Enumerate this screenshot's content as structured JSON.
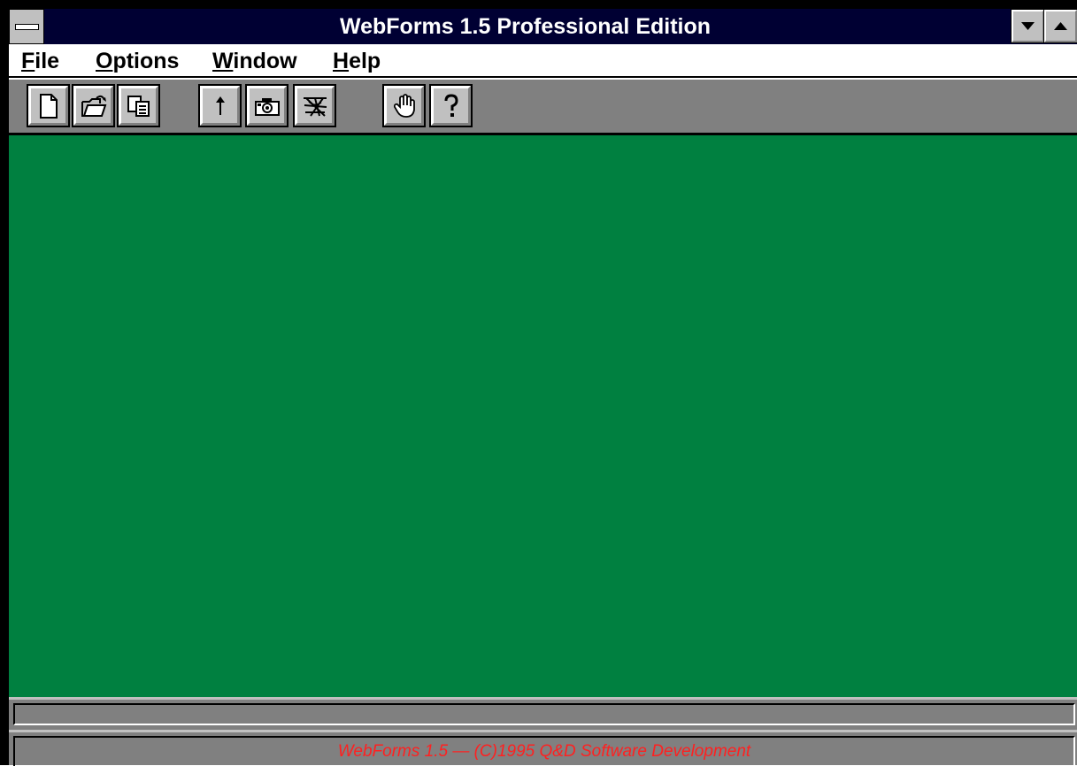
{
  "window": {
    "title": "WebForms 1.5 Professional Edition"
  },
  "menu": {
    "items": [
      {
        "accel": "F",
        "rest": "ile"
      },
      {
        "accel": "O",
        "rest": "ptions"
      },
      {
        "accel": "W",
        "rest": "indow"
      },
      {
        "accel": "H",
        "rest": "elp"
      }
    ]
  },
  "toolbar": {
    "buttons": [
      {
        "icon": "new-document-icon"
      },
      {
        "icon": "open-folder-icon"
      },
      {
        "icon": "copy-icon"
      },
      {
        "icon": "up-arrow-icon"
      },
      {
        "icon": "camera-icon"
      },
      {
        "icon": "spider-web-icon"
      },
      {
        "icon": "hand-icon"
      },
      {
        "icon": "help-question-icon"
      }
    ]
  },
  "workspace": {
    "background_color": "#008040"
  },
  "status": {
    "message": "",
    "copyright": "WebForms 1.5 — (C)1995 Q&D Software Development"
  },
  "colors": {
    "titlebar": "#000033",
    "toolbar": "#808080",
    "copyright_text": "#ff2020"
  }
}
